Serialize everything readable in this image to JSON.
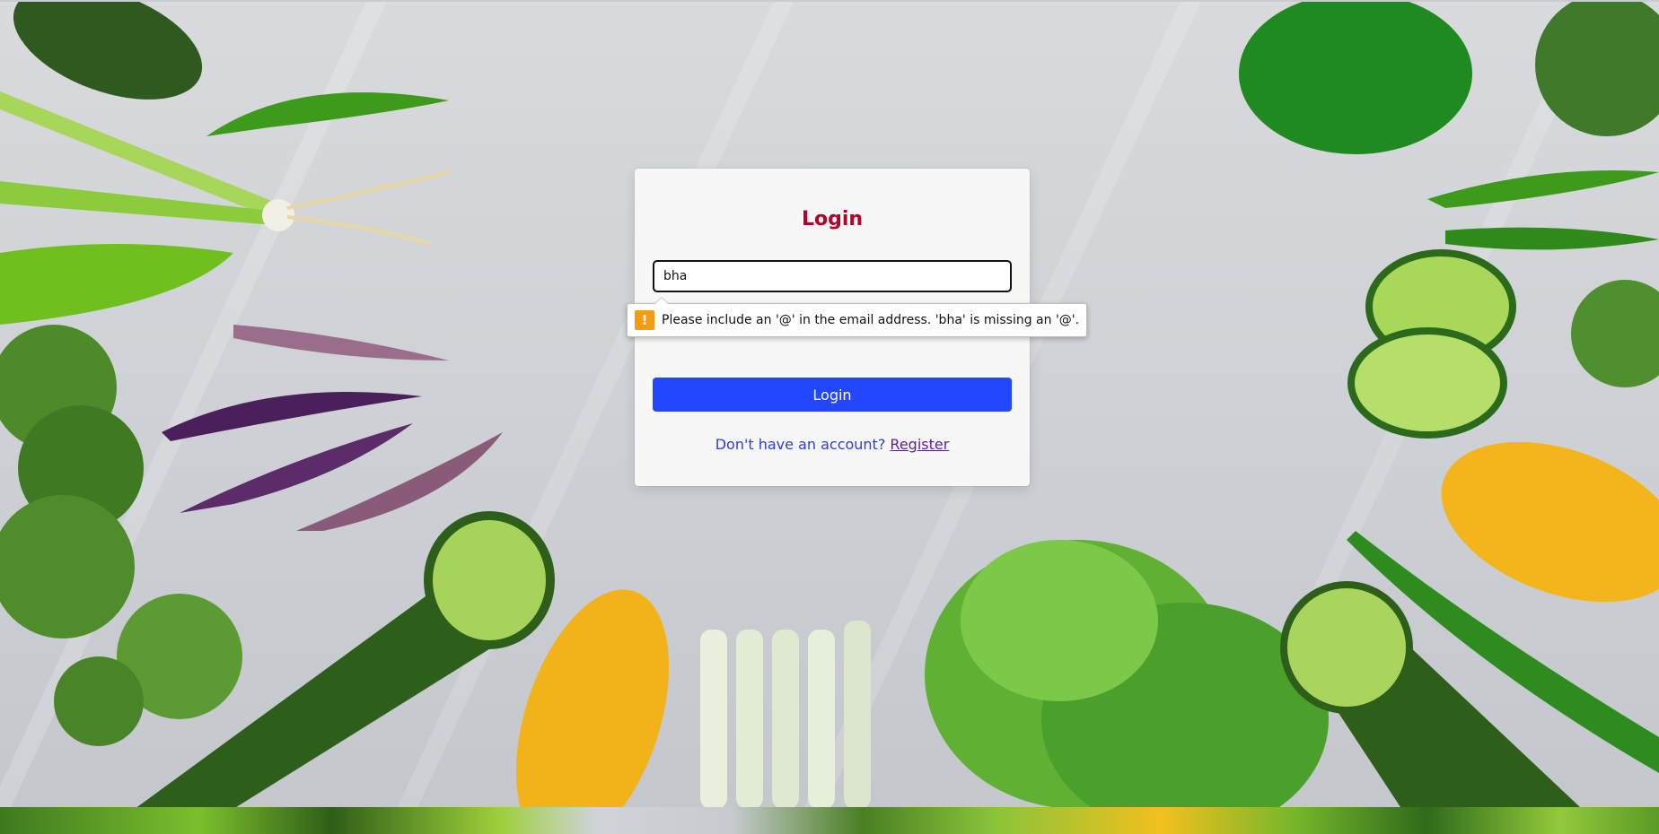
{
  "login": {
    "title": "Login",
    "email_value": "bha",
    "button_label": "Login",
    "register_prompt": "Don't have an account?",
    "register_link": "Register"
  },
  "validation": {
    "message": "Please include an '@' in the email address. 'bha' is missing an '@'.",
    "icon": "warning-icon"
  },
  "colors": {
    "title": "#b5002b",
    "button": "#2347ff",
    "prompt": "#2b3fd8",
    "link": "#5a1f9c",
    "warning": "#f39c12"
  }
}
